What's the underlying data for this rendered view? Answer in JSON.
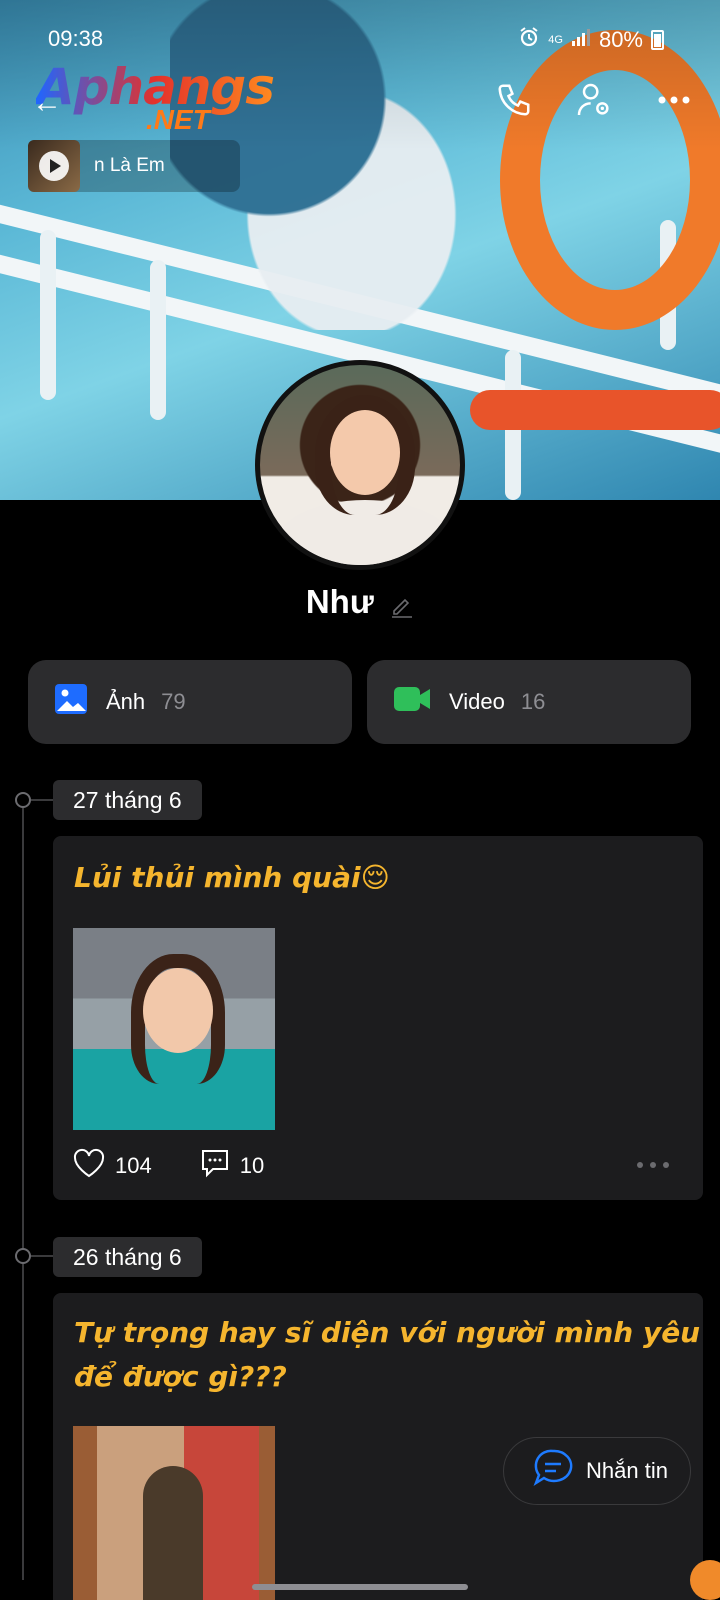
{
  "status_bar": {
    "time": "09:38",
    "network": "4G",
    "battery": "80%"
  },
  "watermark": {
    "main": "Aphangs",
    "sub": ".NET"
  },
  "music": {
    "title": "n Là Em"
  },
  "profile": {
    "name": "Như"
  },
  "media": [
    {
      "label": "Ảnh",
      "count": "79"
    },
    {
      "label": "Video",
      "count": "16"
    }
  ],
  "posts": [
    {
      "date": "27 tháng 6",
      "text": "Lủi thủi mình quài😌",
      "likes": "104",
      "comments": "10"
    },
    {
      "date": "26 tháng 6",
      "text_line1": "Tự trọng hay sĩ diện với người mình yêu",
      "text_line2": "để được gì???"
    }
  ],
  "message_button": {
    "label": "Nhắn tin"
  },
  "colors": {
    "accent_text": "#f5b52e",
    "photo_icon": "#1e6cff",
    "video_icon": "#2fbf5a",
    "chat_icon": "#1e7bff"
  }
}
